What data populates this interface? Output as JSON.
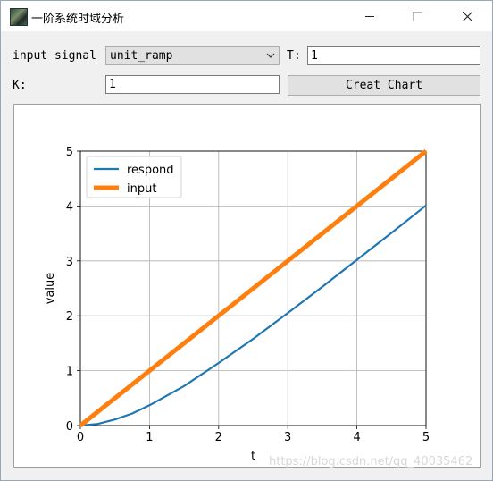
{
  "window": {
    "title": "一阶系统时域分析",
    "icon": "app-icon",
    "controls": {
      "minimize": "minimize-icon",
      "maximize": "maximize-icon",
      "close": "close-icon"
    }
  },
  "form": {
    "input_signal_label": "input signal",
    "input_signal_value": "unit_ramp",
    "T_label": "T:",
    "T_value": "1",
    "K_label": "K:",
    "K_value": "1",
    "button_label": "Creat Chart"
  },
  "colors": {
    "respond": "#1f77b4",
    "input": "#ff7f0e",
    "grid": "#b0b0b0"
  },
  "chart_data": {
    "type": "line",
    "title": "",
    "xlabel": "t",
    "ylabel": "value",
    "xlim": [
      0,
      5
    ],
    "ylim": [
      0,
      5
    ],
    "xticks": [
      "0",
      "1",
      "2",
      "3",
      "4",
      "5"
    ],
    "yticks": [
      "0",
      "1",
      "2",
      "3",
      "4",
      "5"
    ],
    "grid": true,
    "legend_position": "upper left",
    "series": [
      {
        "name": "respond",
        "x": [
          0,
          0.25,
          0.5,
          0.75,
          1,
          1.5,
          2,
          2.5,
          3,
          3.5,
          4,
          4.5,
          5
        ],
        "values": [
          0,
          0.03,
          0.11,
          0.22,
          0.37,
          0.72,
          1.14,
          1.58,
          2.05,
          2.53,
          3.02,
          3.51,
          4.01
        ]
      },
      {
        "name": "input",
        "x": [
          0,
          5
        ],
        "values": [
          0,
          5
        ]
      }
    ]
  },
  "watermark": "https://blog.csdn.net/qq_40035462"
}
